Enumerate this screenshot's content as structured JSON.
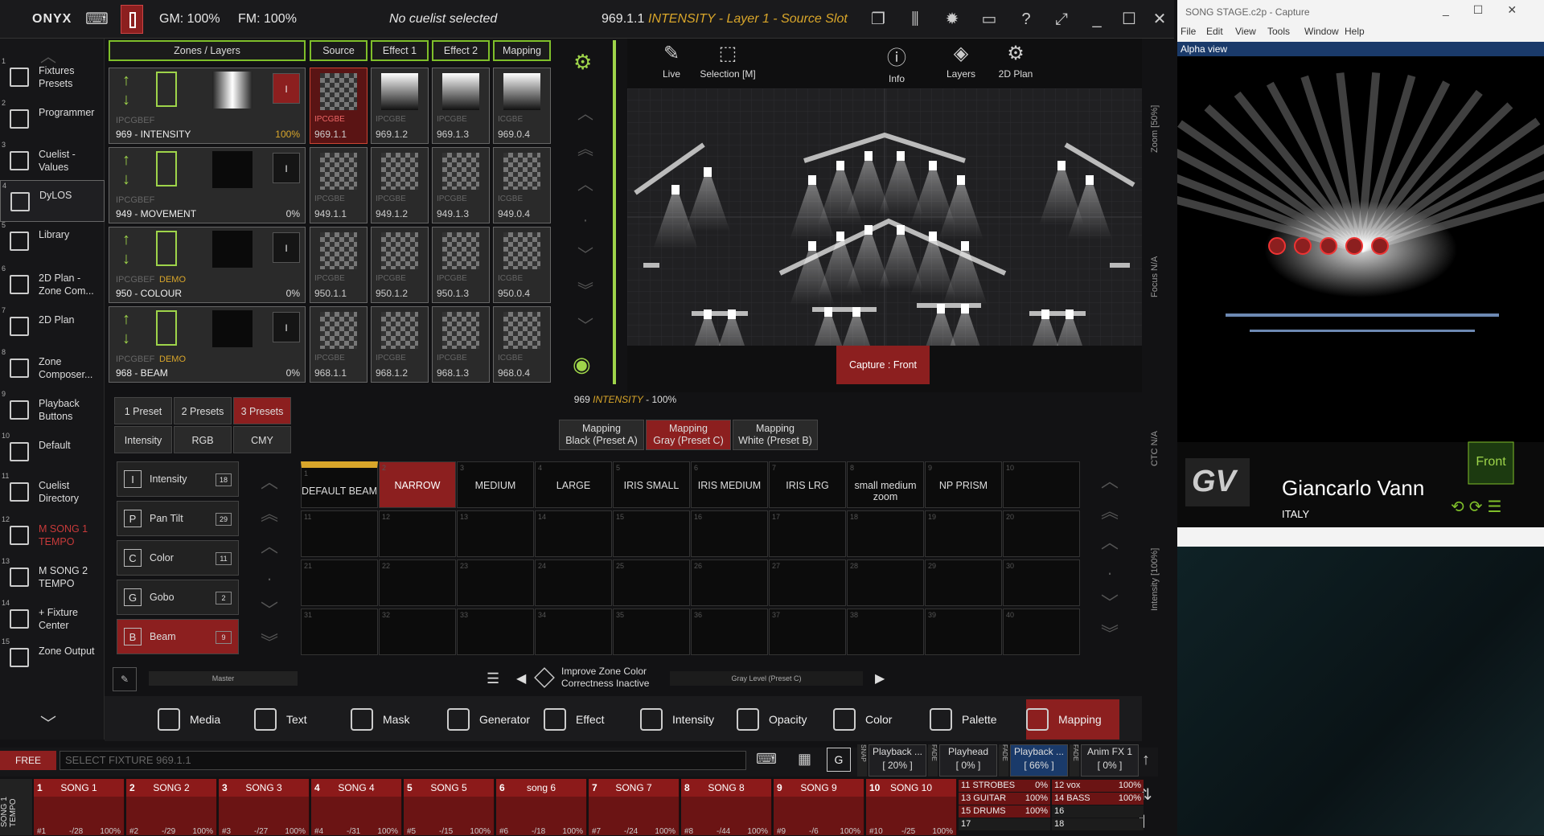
{
  "topbar": {
    "app": "ONYX",
    "gm": "GM: 100%",
    "fm": "FM: 100%",
    "cuelist": "No cuelist selected",
    "slot_id": "969.1.1",
    "slot_desc": "INTENSITY - Layer 1 - Source Slot"
  },
  "sidebar": {
    "items": [
      {
        "n": "1",
        "label": "Fixtures Presets"
      },
      {
        "n": "2",
        "label": "Programmer"
      },
      {
        "n": "3",
        "label": "Cuelist - Values"
      },
      {
        "n": "4",
        "label": "DyLOS"
      },
      {
        "n": "5",
        "label": "Library"
      },
      {
        "n": "6",
        "label": "2D Plan - Zone Com..."
      },
      {
        "n": "7",
        "label": "2D Plan"
      },
      {
        "n": "8",
        "label": "Zone Composer..."
      },
      {
        "n": "9",
        "label": "Playback Buttons"
      },
      {
        "n": "10",
        "label": "Default"
      },
      {
        "n": "11",
        "label": "Cuelist Directory"
      },
      {
        "n": "12",
        "label": "M SONG 1 TEMPO"
      },
      {
        "n": "13",
        "label": "M SONG 2 TEMPO"
      },
      {
        "n": "14",
        "label": "+ Fixture Center"
      },
      {
        "n": "15",
        "label": "Zone Output"
      }
    ]
  },
  "zones": {
    "headers": [
      "Zones / Layers",
      "Source",
      "Effect 1",
      "Effect 2",
      "Mapping"
    ],
    "rows": [
      {
        "tag": "IPCGBEF",
        "demo": "",
        "name": "969 - INTENSITY",
        "pct": "100%",
        "slots": [
          {
            "t": "IPCGBE",
            "n": "969.1.1"
          },
          {
            "t": "IPCGBE",
            "n": "969.1.2"
          },
          {
            "t": "IPCGBE",
            "n": "969.1.3"
          },
          {
            "t": "ICGBE",
            "n": "969.0.4"
          }
        ]
      },
      {
        "tag": "IPCGBEF",
        "demo": "",
        "name": "949 - MOVEMENT",
        "pct": "0%",
        "slots": [
          {
            "t": "IPCGBE",
            "n": "949.1.1"
          },
          {
            "t": "IPCGBE",
            "n": "949.1.2"
          },
          {
            "t": "IPCGBE",
            "n": "949.1.3"
          },
          {
            "t": "ICGBE",
            "n": "949.0.4"
          }
        ]
      },
      {
        "tag": "IPCGBEF",
        "demo": "DEMO",
        "name": "950 - COLOUR",
        "pct": "0%",
        "slots": [
          {
            "t": "IPCGBE",
            "n": "950.1.1"
          },
          {
            "t": "IPCGBE",
            "n": "950.1.2"
          },
          {
            "t": "IPCGBE",
            "n": "950.1.3"
          },
          {
            "t": "ICGBE",
            "n": "950.0.4"
          }
        ]
      },
      {
        "tag": "IPCGBEF",
        "demo": "DEMO",
        "name": "968 - BEAM",
        "pct": "0%",
        "slots": [
          {
            "t": "IPCGBE",
            "n": "968.1.1"
          },
          {
            "t": "IPCGBE",
            "n": "968.1.2"
          },
          {
            "t": "IPCGBE",
            "n": "968.1.3"
          },
          {
            "t": "ICGBE",
            "n": "968.0.4"
          }
        ]
      }
    ],
    "ibtn": "I"
  },
  "preview": {
    "tools": [
      "Live",
      "Selection [M]",
      "Info",
      "Layers",
      "2D Plan"
    ],
    "capture_btn": "Capture : Front",
    "side_labels": [
      "Zoom [50%]",
      "Focus N/A",
      "CTC N/A",
      "Intensity [100%]"
    ]
  },
  "presets": {
    "status_num": "969",
    "status_attr": "INTENSITY",
    "status_pct": "- 100%",
    "count_tabs": [
      "1 Preset",
      "2 Presets",
      "3 Presets"
    ],
    "mode_tabs": [
      "Intensity",
      "RGB",
      "CMY"
    ],
    "mapping_tabs": [
      [
        "Mapping",
        "Black (Preset A)"
      ],
      [
        "Mapping",
        "Gray (Preset C)"
      ],
      [
        "Mapping",
        "White (Preset B)"
      ]
    ],
    "attrs": [
      {
        "k": "I",
        "n": "Intensity",
        "c": "18"
      },
      {
        "k": "P",
        "n": "Pan Tilt",
        "c": "29"
      },
      {
        "k": "C",
        "n": "Color",
        "c": "11"
      },
      {
        "k": "G",
        "n": "Gobo",
        "c": "2"
      },
      {
        "k": "B",
        "n": "Beam",
        "c": "9"
      }
    ],
    "grid": [
      [
        "DEFAULT BEAM",
        "NARROW",
        "MEDIUM",
        "LARGE",
        "IRIS SMALL",
        "IRIS MEDIUM",
        "IRIS LRG",
        "small medium zoom",
        "NP PRISM",
        ""
      ]
    ],
    "master_label": "Master",
    "improve": "Improve Zone Color Correctness Inactive",
    "gray_level": "Gray Level (Preset C)"
  },
  "tools": [
    "Media",
    "Text",
    "Mask",
    "Generator",
    "Effect",
    "Intensity",
    "Opacity",
    "Color",
    "Palette",
    "Mapping"
  ],
  "command": {
    "free": "FREE",
    "placeholder": "SELECT FIXTURE 969.1.1",
    "g": "G"
  },
  "faders": [
    {
      "label": "Playback ...",
      "val": "[ 20% ]",
      "side": "SNAP"
    },
    {
      "label": "Playhead",
      "val": "[ 0% ]",
      "side": "FADE"
    },
    {
      "label": "Playback ...",
      "val": "[ 66% ]",
      "side": "FADE"
    },
    {
      "label": "Anim FX 1",
      "val": "[ 0% ]",
      "side": "FADE"
    }
  ],
  "playbacks": [
    {
      "n": "1",
      "t": "SONG 1",
      "f": "#1",
      "v": "-/28",
      "p": "100%"
    },
    {
      "n": "2",
      "t": "SONG 2",
      "f": "#2",
      "v": "-/29",
      "p": "100%"
    },
    {
      "n": "3",
      "t": "SONG 3",
      "f": "#3",
      "v": "-/27",
      "p": "100%"
    },
    {
      "n": "4",
      "t": "SONG 4",
      "f": "#4",
      "v": "-/31",
      "p": "100%"
    },
    {
      "n": "5",
      "t": "SONG 5",
      "f": "#5",
      "v": "-/15",
      "p": "100%"
    },
    {
      "n": "6",
      "t": "song 6",
      "f": "#6",
      "v": "-/18",
      "p": "100%"
    },
    {
      "n": "7",
      "t": "SONG 7",
      "f": "#7",
      "v": "-/24",
      "p": "100%"
    },
    {
      "n": "8",
      "t": "SONG 8",
      "f": "#8",
      "v": "-/44",
      "p": "100%"
    },
    {
      "n": "9",
      "t": "SONG 9",
      "f": "#9",
      "v": "-/6",
      "p": "100%"
    },
    {
      "n": "10",
      "t": "SONG 10",
      "f": "#10",
      "v": "-/25",
      "p": "100%"
    }
  ],
  "bank_label": "SONG 1 TEMPO",
  "mini": [
    {
      "t": "11 STROBES",
      "p": "0%"
    },
    {
      "t": "12 vox",
      "p": "100%"
    },
    {
      "t": "13 GUITAR",
      "p": "100%"
    },
    {
      "t": "14 BASS",
      "p": "100%"
    },
    {
      "t": "15 DRUMS",
      "p": "100%"
    },
    {
      "t": "16",
      "p": ""
    },
    {
      "t": "17",
      "p": ""
    },
    {
      "t": "18",
      "p": ""
    }
  ],
  "capture": {
    "title": "SONG STAGE.c2p - Capture",
    "menu": [
      "File",
      "Edit",
      "View",
      "Tools",
      "Window",
      "Help"
    ],
    "view_title": "Alpha view",
    "name": "Giancarlo Vann",
    "country": "ITALY",
    "front": "Front",
    "logo": "GV"
  },
  "colors": {
    "accent_red": "#8c1f1f",
    "accent_green": "#7fbf2a",
    "amber": "#d9a62a"
  }
}
